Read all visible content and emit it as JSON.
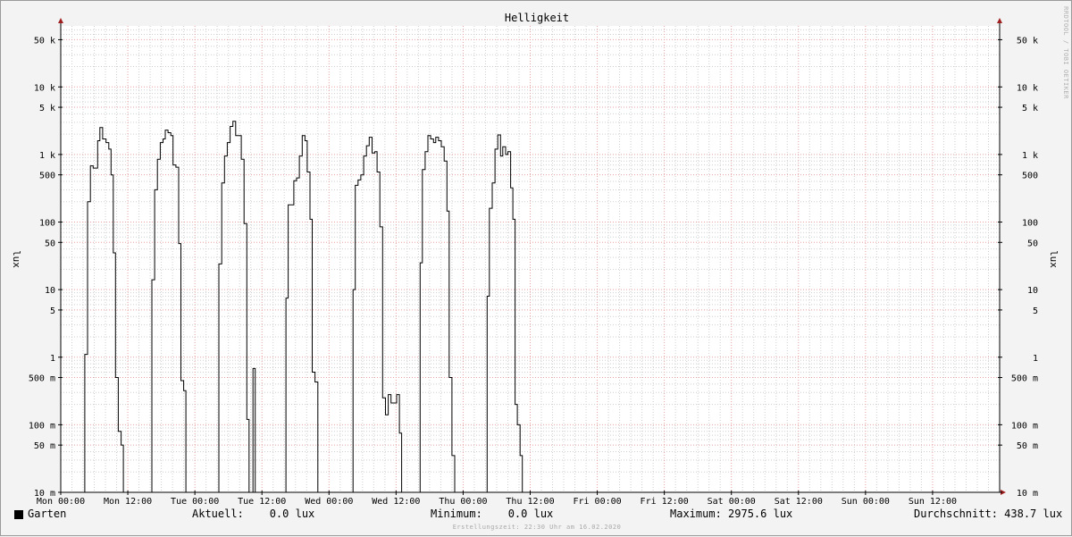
{
  "chart_data": {
    "type": "line",
    "title": "Helligkeit",
    "ylabel": "lux",
    "ylabel_right": "lux",
    "yscale": "log",
    "ylim": [
      0.01,
      80000
    ],
    "xlim_hours": [
      0,
      168
    ],
    "watermark": "RRDTOOL / TOBI OETIKER",
    "y_ticks": [
      {
        "v": 50000,
        "label": "50 k"
      },
      {
        "v": 10000,
        "label": "10 k"
      },
      {
        "v": 5000,
        "label": "5 k"
      },
      {
        "v": 1000,
        "label": "1 k"
      },
      {
        "v": 500,
        "label": "500"
      },
      {
        "v": 100,
        "label": "100"
      },
      {
        "v": 50,
        "label": "50"
      },
      {
        "v": 10,
        "label": "10"
      },
      {
        "v": 5,
        "label": "5"
      },
      {
        "v": 1,
        "label": "1"
      },
      {
        "v": 0.5,
        "label": "500 m"
      },
      {
        "v": 0.1,
        "label": "100 m"
      },
      {
        "v": 0.05,
        "label": "50 m"
      },
      {
        "v": 0.01,
        "label": "10 m"
      }
    ],
    "x_ticks": [
      {
        "h": 0,
        "label": "Mon 00:00"
      },
      {
        "h": 12,
        "label": "Mon 12:00"
      },
      {
        "h": 24,
        "label": "Tue 00:00"
      },
      {
        "h": 36,
        "label": "Tue 12:00"
      },
      {
        "h": 48,
        "label": "Wed 00:00"
      },
      {
        "h": 60,
        "label": "Wed 12:00"
      },
      {
        "h": 72,
        "label": "Thu 00:00"
      },
      {
        "h": 84,
        "label": "Thu 12:00"
      },
      {
        "h": 96,
        "label": "Fri 00:00"
      },
      {
        "h": 108,
        "label": "Fri 12:00"
      },
      {
        "h": 120,
        "label": "Sat 00:00"
      },
      {
        "h": 132,
        "label": "Sat 12:00"
      },
      {
        "h": 144,
        "label": "Sun 00:00"
      },
      {
        "h": 156,
        "label": "Sun 12:00"
      }
    ],
    "series": [
      {
        "name": "Garten",
        "color": "#000000",
        "points": [
          [
            0,
            0.01
          ],
          [
            4.3,
            0.01
          ],
          [
            4.3,
            1.1
          ],
          [
            4.8,
            1.1
          ],
          [
            4.8,
            200
          ],
          [
            5.3,
            200
          ],
          [
            5.3,
            680
          ],
          [
            5.8,
            680
          ],
          [
            5.8,
            630
          ],
          [
            6.6,
            630
          ],
          [
            6.6,
            1600
          ],
          [
            7,
            1600
          ],
          [
            7,
            2500
          ],
          [
            7.5,
            2500
          ],
          [
            7.5,
            1700
          ],
          [
            8.1,
            1700
          ],
          [
            8.1,
            1500
          ],
          [
            8.6,
            1500
          ],
          [
            8.6,
            1200
          ],
          [
            9,
            1200
          ],
          [
            9,
            500
          ],
          [
            9.4,
            500
          ],
          [
            9.4,
            35
          ],
          [
            9.8,
            35
          ],
          [
            9.8,
            0.5
          ],
          [
            10.3,
            0.5
          ],
          [
            10.3,
            0.08
          ],
          [
            10.8,
            0.08
          ],
          [
            10.8,
            0.05
          ],
          [
            11.2,
            0.05
          ],
          [
            11.2,
            0.01
          ],
          [
            16.3,
            0.01
          ],
          [
            16.3,
            14
          ],
          [
            16.8,
            14
          ],
          [
            16.8,
            300
          ],
          [
            17.3,
            300
          ],
          [
            17.3,
            850
          ],
          [
            17.8,
            850
          ],
          [
            17.8,
            1500
          ],
          [
            18.3,
            1500
          ],
          [
            18.3,
            1700
          ],
          [
            18.7,
            1700
          ],
          [
            18.7,
            2300
          ],
          [
            19.2,
            2300
          ],
          [
            19.2,
            2100
          ],
          [
            19.7,
            2100
          ],
          [
            19.7,
            1900
          ],
          [
            20.1,
            1900
          ],
          [
            20.1,
            700
          ],
          [
            20.6,
            700
          ],
          [
            20.6,
            650
          ],
          [
            21.1,
            650
          ],
          [
            21.1,
            48
          ],
          [
            21.5,
            48
          ],
          [
            21.5,
            0.45
          ],
          [
            22,
            0.45
          ],
          [
            22,
            0.32
          ],
          [
            22.4,
            0.32
          ],
          [
            22.4,
            0.01
          ],
          [
            28.3,
            0.01
          ],
          [
            28.3,
            24
          ],
          [
            28.8,
            24
          ],
          [
            28.8,
            380
          ],
          [
            29.3,
            380
          ],
          [
            29.3,
            950
          ],
          [
            29.8,
            950
          ],
          [
            29.8,
            1500
          ],
          [
            30.3,
            1500
          ],
          [
            30.3,
            2600
          ],
          [
            30.8,
            2600
          ],
          [
            30.8,
            3100
          ],
          [
            31.3,
            3100
          ],
          [
            31.3,
            1900
          ],
          [
            32.3,
            1900
          ],
          [
            32.3,
            850
          ],
          [
            32.8,
            850
          ],
          [
            32.8,
            95
          ],
          [
            33.3,
            95
          ],
          [
            33.3,
            0.12
          ],
          [
            33.7,
            0.12
          ],
          [
            33.7,
            0.01
          ],
          [
            34.4,
            0.01
          ],
          [
            34.4,
            0.68
          ],
          [
            34.8,
            0.68
          ],
          [
            34.8,
            0.01
          ],
          [
            40.3,
            0.01
          ],
          [
            40.3,
            7.5
          ],
          [
            40.7,
            7.5
          ],
          [
            40.7,
            180
          ],
          [
            41.7,
            180
          ],
          [
            41.7,
            410
          ],
          [
            42.2,
            410
          ],
          [
            42.2,
            450
          ],
          [
            42.7,
            450
          ],
          [
            42.7,
            950
          ],
          [
            43.2,
            950
          ],
          [
            43.2,
            1900
          ],
          [
            43.7,
            1900
          ],
          [
            43.7,
            1600
          ],
          [
            44.1,
            1600
          ],
          [
            44.1,
            550
          ],
          [
            44.6,
            550
          ],
          [
            44.6,
            110
          ],
          [
            45,
            110
          ],
          [
            45,
            0.6
          ],
          [
            45.5,
            0.6
          ],
          [
            45.5,
            0.43
          ],
          [
            46,
            0.43
          ],
          [
            46,
            0.01
          ],
          [
            52.3,
            0.01
          ],
          [
            52.3,
            10
          ],
          [
            52.7,
            10
          ],
          [
            52.7,
            350
          ],
          [
            53.2,
            350
          ],
          [
            53.2,
            420
          ],
          [
            53.7,
            420
          ],
          [
            53.7,
            500
          ],
          [
            54.2,
            500
          ],
          [
            54.2,
            950
          ],
          [
            54.7,
            950
          ],
          [
            54.7,
            1350
          ],
          [
            55.2,
            1350
          ],
          [
            55.2,
            1800
          ],
          [
            55.7,
            1800
          ],
          [
            55.7,
            1050
          ],
          [
            56.2,
            1050
          ],
          [
            56.2,
            1100
          ],
          [
            56.6,
            1100
          ],
          [
            56.6,
            550
          ],
          [
            57.1,
            550
          ],
          [
            57.1,
            85
          ],
          [
            57.6,
            85
          ],
          [
            57.6,
            0.25
          ],
          [
            58.1,
            0.25
          ],
          [
            58.1,
            0.14
          ],
          [
            58.6,
            0.14
          ],
          [
            58.6,
            0.28
          ],
          [
            59.1,
            0.28
          ],
          [
            59.1,
            0.21
          ],
          [
            60.1,
            0.21
          ],
          [
            60.1,
            0.28
          ],
          [
            60.6,
            0.28
          ],
          [
            60.6,
            0.075
          ],
          [
            61,
            0.075
          ],
          [
            61,
            0.01
          ],
          [
            64.3,
            0.01
          ],
          [
            64.3,
            25
          ],
          [
            64.7,
            25
          ],
          [
            64.7,
            600
          ],
          [
            65.2,
            600
          ],
          [
            65.2,
            1100
          ],
          [
            65.7,
            1100
          ],
          [
            65.7,
            1900
          ],
          [
            66.2,
            1900
          ],
          [
            66.2,
            1700
          ],
          [
            66.7,
            1700
          ],
          [
            66.7,
            1500
          ],
          [
            67.1,
            1500
          ],
          [
            67.1,
            1800
          ],
          [
            67.6,
            1800
          ],
          [
            67.6,
            1600
          ],
          [
            68.1,
            1600
          ],
          [
            68.1,
            1300
          ],
          [
            68.6,
            1300
          ],
          [
            68.6,
            800
          ],
          [
            69.1,
            800
          ],
          [
            69.1,
            145
          ],
          [
            69.5,
            145
          ],
          [
            69.5,
            0.5
          ],
          [
            70,
            0.5
          ],
          [
            70,
            0.035
          ],
          [
            70.5,
            0.035
          ],
          [
            70.5,
            0.01
          ],
          [
            76.3,
            0.01
          ],
          [
            76.3,
            8
          ],
          [
            76.7,
            8
          ],
          [
            76.7,
            160
          ],
          [
            77.2,
            160
          ],
          [
            77.2,
            380
          ],
          [
            77.7,
            380
          ],
          [
            77.7,
            1200
          ],
          [
            78.2,
            1200
          ],
          [
            78.2,
            1950
          ],
          [
            78.7,
            1950
          ],
          [
            78.7,
            950
          ],
          [
            79.1,
            950
          ],
          [
            79.1,
            1300
          ],
          [
            79.6,
            1300
          ],
          [
            79.6,
            1000
          ],
          [
            80,
            1000
          ],
          [
            80,
            1100
          ],
          [
            80.5,
            1100
          ],
          [
            80.5,
            320
          ],
          [
            80.9,
            320
          ],
          [
            80.9,
            110
          ],
          [
            81.3,
            110
          ],
          [
            81.3,
            0.2
          ],
          [
            81.7,
            0.2
          ],
          [
            81.7,
            0.1
          ],
          [
            82.2,
            0.1
          ],
          [
            82.2,
            0.035
          ],
          [
            82.6,
            0.035
          ],
          [
            82.6,
            0.01
          ],
          [
            84,
            0.01
          ]
        ]
      }
    ]
  },
  "legend": {
    "series_name": "Garten",
    "aktuell": "Aktuell:    0.0 lux",
    "minimum": "Minimum:    0.0 lux",
    "maximum": "Maximum: 2975.6 lux",
    "durchschnitt": "Durchschnitt: 438.7 lux"
  },
  "footer": "Erstellungszeit: 22:30 Uhr am 16.02.2020",
  "colors": {
    "grid_major": "#e8a0a0",
    "grid_minor": "#cfcfcf",
    "plot_bg": "#ffffff",
    "axis": "#000000",
    "arrow": "#a02020"
  }
}
